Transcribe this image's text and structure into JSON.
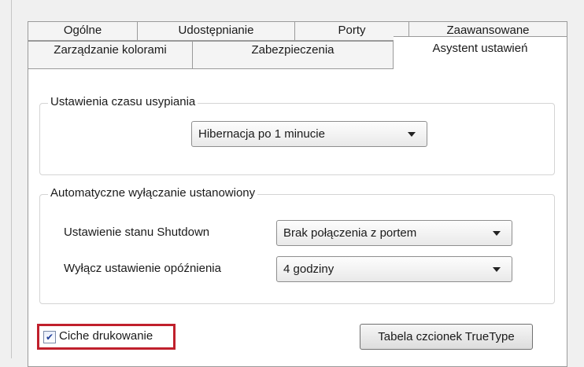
{
  "tabs": {
    "row1": [
      "Ogólne",
      "Udostępnianie",
      "Porty",
      "Zaawansowane"
    ],
    "row2": [
      "Zarządzanie kolorami",
      "Zabezpieczenia",
      "Asystent ustawień"
    ],
    "active": "Asystent ustawień"
  },
  "sleep_group": {
    "legend": "Ustawienia czasu usypiania",
    "combo_value": "Hibernacja po 1 minucie"
  },
  "shutdown_group": {
    "legend": "Automatyczne wyłączanie ustanowiony",
    "state_label": "Ustawienie stanu Shutdown",
    "state_value": "Brak połączenia z portem",
    "delay_label": "Wyłącz ustawienie opóźnienia",
    "delay_value": "4 godziny"
  },
  "quiet_print": {
    "label": "Ciche drukowanie",
    "checked": true
  },
  "truetype_button": "Tabela czcionek TrueType"
}
